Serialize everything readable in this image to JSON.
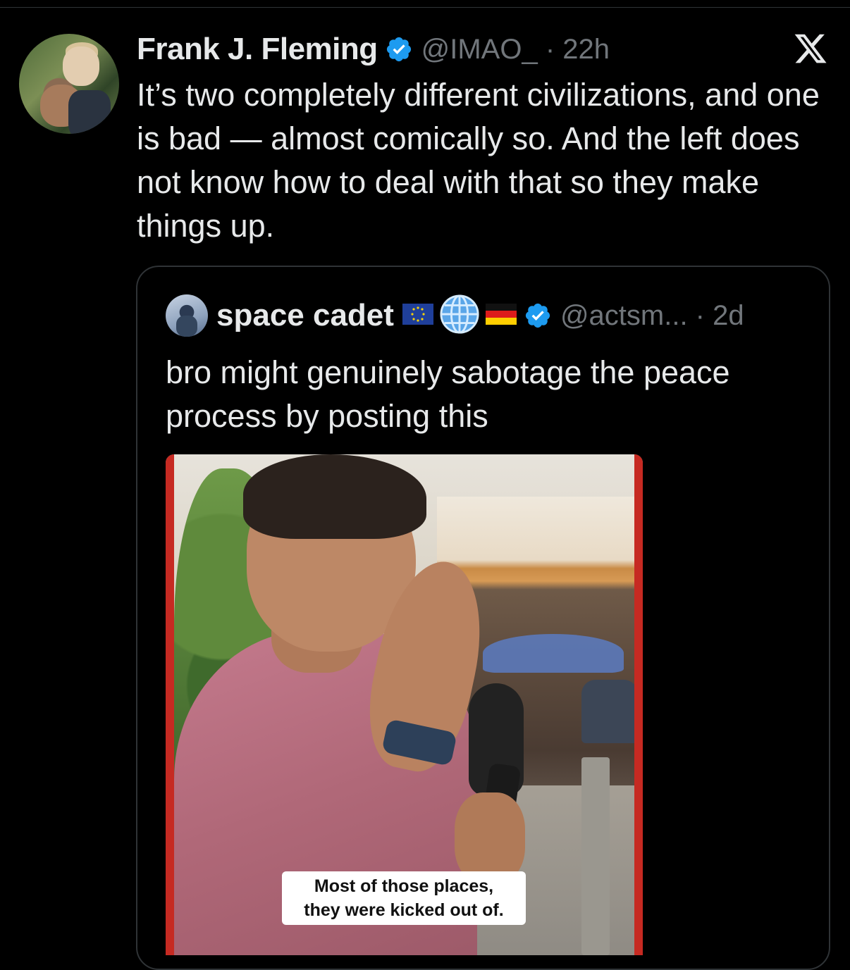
{
  "tweet": {
    "author_name": "Frank J. Fleming",
    "handle_time": "@IMAO_ · 22h",
    "text": "It’s two completely different civilizations, and one is bad — almost comically so. And the left does not know how to deal with that so they make things up."
  },
  "quoted_tweet": {
    "author_name": "space cadet",
    "handle_time": "@actsm... · 2d",
    "text": "bro might genuinely sabotage the peace process by posting this",
    "media": {
      "caption_line1": "Most of those places,",
      "caption_line2": "they were kicked out of."
    }
  },
  "icons": {
    "verified": "verified-badge-icon",
    "platform": "x-logo-icon",
    "flags": [
      "eu-flag-icon",
      "globe-icon",
      "germany-flag-icon"
    ]
  },
  "colors": {
    "background": "#000000",
    "text": "#e7e9ea",
    "secondary": "#71767b",
    "verified": "#1d9bf0",
    "border": "#2f3336"
  }
}
